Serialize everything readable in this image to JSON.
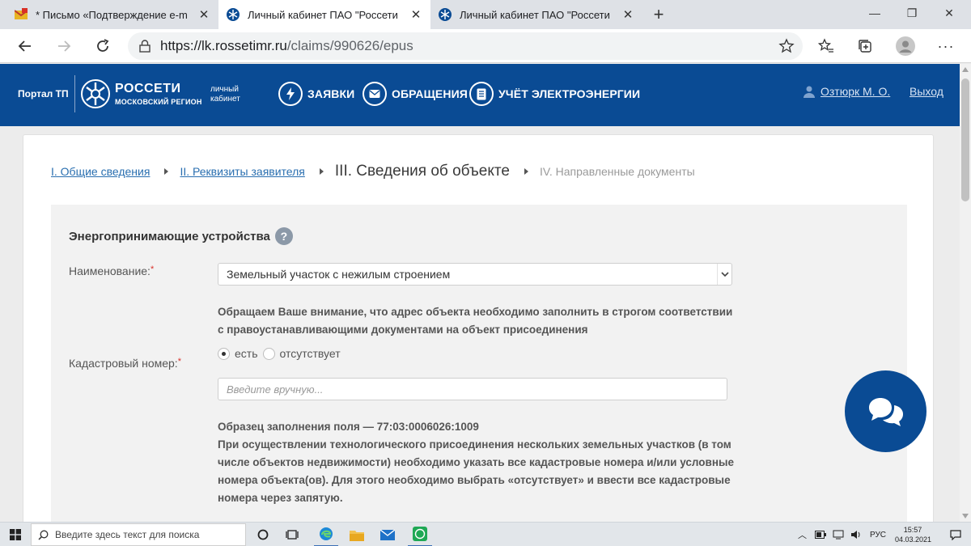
{
  "browser": {
    "tabs": [
      {
        "title": "* Письмо «Подтверждение e-m",
        "icon": "mail-icon",
        "active": false
      },
      {
        "title": "Личный кабинет ПАО \"Россети",
        "icon": "rosseti-icon",
        "active": true
      },
      {
        "title": "Личный кабинет ПАО \"Россети",
        "icon": "rosseti-icon",
        "active": false
      }
    ],
    "url_host": "https://lk.rossetimr.ru",
    "url_path": "/claims/990626/epus"
  },
  "header": {
    "portal": "Портал ТП",
    "logo_name": "РОССЕТИ",
    "logo_region": "МОСКОВСКИЙ РЕГИОН",
    "cabinet_line1": "личный",
    "cabinet_line2": "кабинет",
    "nav": [
      {
        "label": "ЗАЯВКИ",
        "icon": "lightning-icon"
      },
      {
        "label": "ОБРАЩЕНИЯ",
        "icon": "envelope-icon"
      },
      {
        "label": "УЧЁТ ЭЛЕКТРОЭНЕРГИИ",
        "icon": "document-icon"
      }
    ],
    "user_name": "Озтюрк М. О.",
    "logout": "Выход"
  },
  "breadcrumbs": {
    "step1": "I. Общие сведения",
    "step2": "II. Реквизиты заявителя",
    "step3": "III. Сведения об объекте",
    "step4": "IV. Направленные документы"
  },
  "form": {
    "section_title": "Энергопринимающие устройства",
    "help_glyph": "?",
    "name_label": "Наименование:",
    "required_mark": "*",
    "name_value": "Земельный участок с нежилым строением",
    "address_note_line1": "Обращаем Ваше внимание, что адрес объекта необходимо заполнить в строгом соответствии",
    "address_note_line2": "с правоустанавливающими документами на объект присоединения",
    "cadastral_label": "Кадастровый номер:",
    "radio_yes": "есть",
    "radio_no": "отсутствует",
    "radio_selected": "есть",
    "cadastral_placeholder": "Введите вручную...",
    "sample_line": "Образец заполнения поля — 77:03:0006026:1009",
    "multi_note_line1": "При осуществлении технологического присоединения нескольких земельных участков (в том",
    "multi_note_line2": "числе объектов недвижимости) необходимо указать все кадастровые номера и/или условные",
    "multi_note_line3": "номера объекта(ов). Для этого необходимо выбрать «отсутствует» и ввести все кадастровые",
    "multi_note_line4": "номера через запятую."
  },
  "taskbar": {
    "search_placeholder": "Введите здесь текст для поиска",
    "language": "РУС",
    "time": "15:57",
    "date": "04.03.2021"
  },
  "colors": {
    "brand": "#0a4b94",
    "link": "#2a6fb0",
    "required": "#d9322b"
  }
}
